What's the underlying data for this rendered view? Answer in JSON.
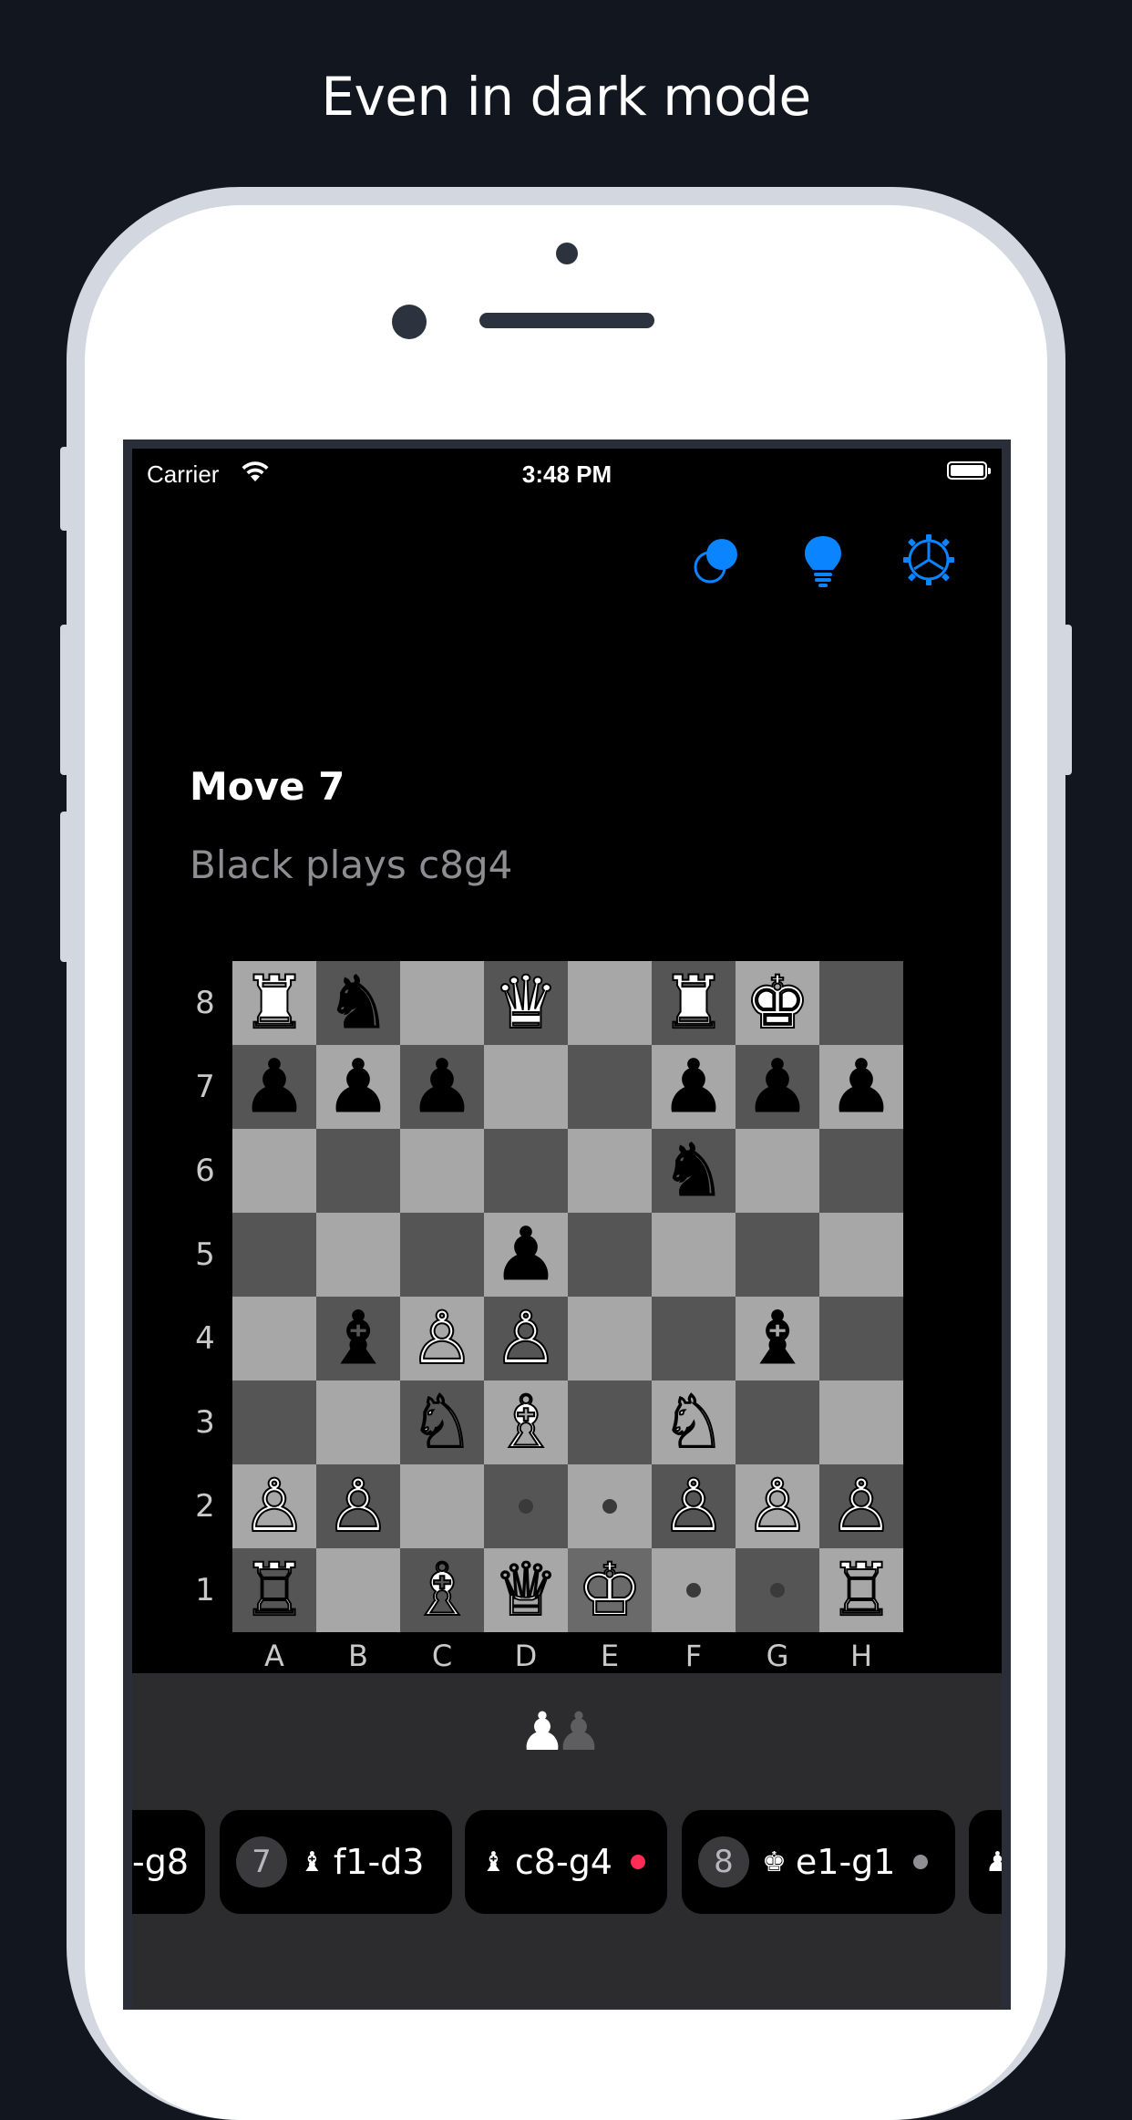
{
  "headline": "Even in dark mode",
  "status_bar": {
    "carrier": "Carrier",
    "time": "3:48 PM"
  },
  "toolbar": {
    "accent_color": "#0a84ff",
    "icons": [
      "compare-icon",
      "lightbulb-icon",
      "gear-icon"
    ]
  },
  "move": {
    "title": "Move 7",
    "description": "Black plays c8g4"
  },
  "board": {
    "ranks": [
      "8",
      "7",
      "6",
      "5",
      "4",
      "3",
      "2",
      "1"
    ],
    "files": [
      "A",
      "B",
      "C",
      "D",
      "E",
      "F",
      "G",
      "H"
    ],
    "pieces": [
      {
        "square": "a8",
        "glyph": "♜",
        "color": "w"
      },
      {
        "square": "b8",
        "glyph": "♞",
        "color": "b"
      },
      {
        "square": "d8",
        "glyph": "♛",
        "color": "w"
      },
      {
        "square": "f8",
        "glyph": "♜",
        "color": "w"
      },
      {
        "square": "g8",
        "glyph": "♚",
        "color": "w"
      },
      {
        "square": "a7",
        "glyph": "♟",
        "color": "b"
      },
      {
        "square": "b7",
        "glyph": "♟",
        "color": "b"
      },
      {
        "square": "c7",
        "glyph": "♟",
        "color": "b"
      },
      {
        "square": "f7",
        "glyph": "♟",
        "color": "b"
      },
      {
        "square": "g7",
        "glyph": "♟",
        "color": "b"
      },
      {
        "square": "h7",
        "glyph": "♟",
        "color": "b"
      },
      {
        "square": "f6",
        "glyph": "♞",
        "color": "b"
      },
      {
        "square": "d5",
        "glyph": "♟",
        "color": "b"
      },
      {
        "square": "b4",
        "glyph": "♝",
        "color": "b"
      },
      {
        "square": "c4",
        "glyph": "♙",
        "color": "w"
      },
      {
        "square": "d4",
        "glyph": "♙",
        "color": "w"
      },
      {
        "square": "g4",
        "glyph": "♝",
        "color": "b"
      },
      {
        "square": "c3",
        "glyph": "♘",
        "color": "w"
      },
      {
        "square": "d3",
        "glyph": "♗",
        "color": "w"
      },
      {
        "square": "f3",
        "glyph": "♘",
        "color": "w"
      },
      {
        "square": "a2",
        "glyph": "♙",
        "color": "w"
      },
      {
        "square": "b2",
        "glyph": "♙",
        "color": "w"
      },
      {
        "square": "f2",
        "glyph": "♙",
        "color": "w"
      },
      {
        "square": "g2",
        "glyph": "♙",
        "color": "w"
      },
      {
        "square": "h2",
        "glyph": "♙",
        "color": "w"
      },
      {
        "square": "a1",
        "glyph": "♖",
        "color": "w"
      },
      {
        "square": "c1",
        "glyph": "♗",
        "color": "w"
      },
      {
        "square": "d1",
        "glyph": "♕",
        "color": "w"
      },
      {
        "square": "e1",
        "glyph": "♔",
        "color": "w"
      },
      {
        "square": "h1",
        "glyph": "♖",
        "color": "w"
      }
    ],
    "move_hints": [
      "d2",
      "e2",
      "f1",
      "g1"
    ],
    "highlighted": [
      "e1"
    ]
  },
  "turn_indicator": {
    "white_glyph": "♟",
    "black_glyph": "♟"
  },
  "move_history": [
    {
      "number": "",
      "piece": "",
      "text": "-g8",
      "indicator": ""
    },
    {
      "number": "7",
      "piece": "♝",
      "text": "f1-d3",
      "indicator": ""
    },
    {
      "number": "",
      "piece": "♝",
      "text": "c8-g4",
      "indicator": "#ff2d55"
    },
    {
      "number": "8",
      "piece": "♚",
      "text": "e1-g1",
      "indicator": "#8e8e93"
    },
    {
      "number": "",
      "piece": "♟",
      "text": "",
      "indicator": ""
    }
  ]
}
